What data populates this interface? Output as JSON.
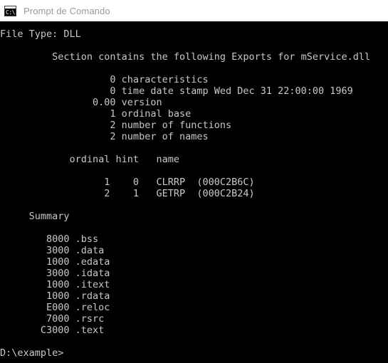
{
  "window": {
    "titlebar": {
      "icon_name": "command-prompt-icon",
      "icon_glyph": "C:\\",
      "title": "Prompt de Comando"
    },
    "colors": {
      "titlebar_background": "#ffffff",
      "titlebar_text": "#9a9a9a",
      "console_background": "#000000",
      "console_text": "#c8c8c8"
    }
  },
  "console": {
    "lines": [
      "File Type: DLL",
      "",
      "         Section contains the following Exports for mService.dll",
      "",
      "                   0 characteristics",
      "                   0 time date stamp Wed Dec 31 22:00:00 1969",
      "                0.00 version",
      "                   1 ordinal base",
      "                   2 number of functions",
      "                   2 number of names",
      "",
      "            ordinal hint   name",
      "",
      "                  1    0   CLRRP  (000C2B6C)",
      "                  2    1   GETRP  (000C2B24)",
      "",
      "     Summary",
      "",
      "        8000 .bss",
      "        3000 .data",
      "        1000 .edata",
      "        3000 .idata",
      "        1000 .itext",
      "        1000 .rdata",
      "        E000 .reloc",
      "        7000 .rsrc",
      "       C3000 .text",
      "",
      "D:\\example>"
    ],
    "details": {
      "file_type_label": "File Type:",
      "file_type_value": "DLL",
      "exports_header": "Section contains the following Exports for mService.dll",
      "module_name": "mService.dll",
      "header_fields": [
        {
          "value": "0",
          "label": "characteristics"
        },
        {
          "value": "0",
          "label": "time date stamp Wed Dec 31 22:00:00 1969"
        },
        {
          "value": "0.00",
          "label": "version"
        },
        {
          "value": "1",
          "label": "ordinal base"
        },
        {
          "value": "2",
          "label": "number of functions"
        },
        {
          "value": "2",
          "label": "number of names"
        }
      ],
      "exports_table": {
        "columns": [
          "ordinal",
          "hint",
          "name"
        ],
        "rows": [
          {
            "ordinal": "1",
            "hint": "0",
            "name": "CLRRP",
            "address": "(000C2B6C)"
          },
          {
            "ordinal": "2",
            "hint": "1",
            "name": "GETRP",
            "address": "(000C2B24)"
          }
        ]
      },
      "summary_title": "Summary",
      "summary_sections": [
        {
          "size": "8000",
          "name": ".bss"
        },
        {
          "size": "3000",
          "name": ".data"
        },
        {
          "size": "1000",
          "name": ".edata"
        },
        {
          "size": "3000",
          "name": ".idata"
        },
        {
          "size": "1000",
          "name": ".itext"
        },
        {
          "size": "1000",
          "name": ".rdata"
        },
        {
          "size": "E000",
          "name": ".reloc"
        },
        {
          "size": "7000",
          "name": ".rsrc"
        },
        {
          "size": "C3000",
          "name": ".text"
        }
      ],
      "prompt": "D:\\example>"
    }
  }
}
